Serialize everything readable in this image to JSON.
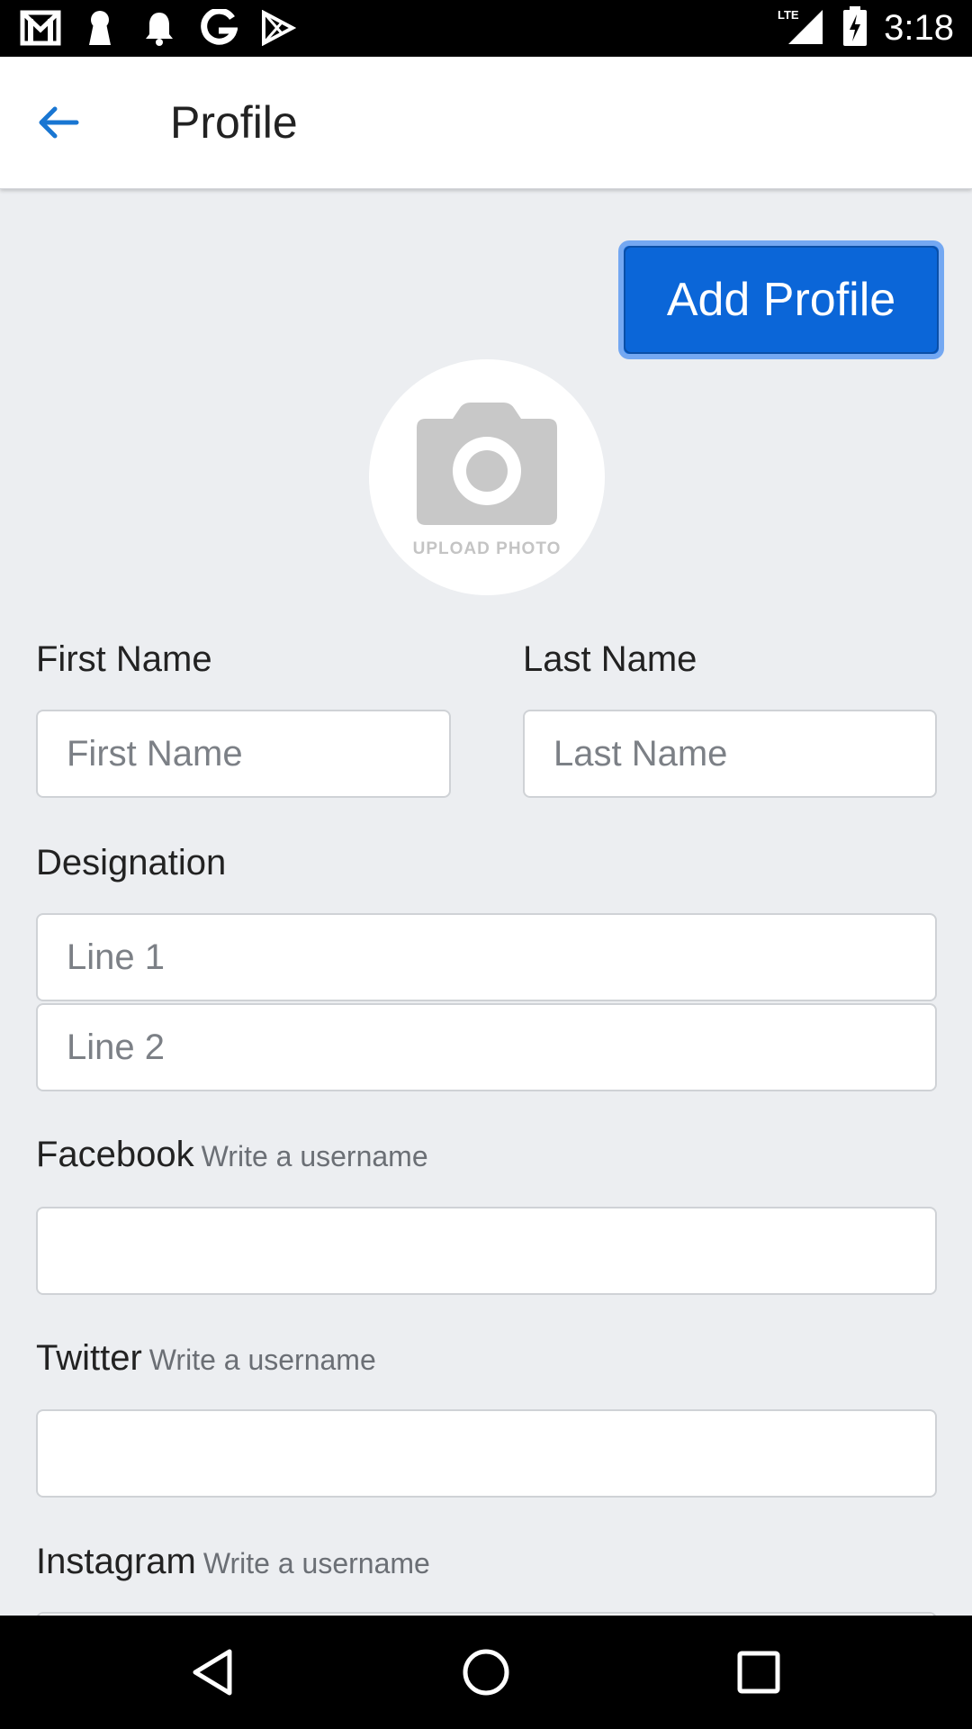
{
  "status_bar": {
    "time": "3:18",
    "network": "LTE",
    "icons": [
      "gmail-icon",
      "keyhole-icon",
      "bell-icon",
      "google-icon",
      "play-store-icon",
      "signal-icon",
      "battery-icon"
    ]
  },
  "app_bar": {
    "title": "Profile",
    "back_icon": "arrow-left-icon",
    "accent": "#1976d2"
  },
  "actions": {
    "add_profile_label": "Add Profile",
    "button_color": "#0b66d8"
  },
  "photo": {
    "upload_label": "UPLOAD PHOTO",
    "icon": "camera-icon"
  },
  "form": {
    "first_name": {
      "label": "First Name",
      "placeholder": "First Name",
      "value": ""
    },
    "last_name": {
      "label": "Last Name",
      "placeholder": "Last Name",
      "value": ""
    },
    "designation": {
      "label": "Designation",
      "line1_placeholder": "Line 1",
      "line2_placeholder": "Line 2"
    },
    "facebook": {
      "label": "Facebook",
      "hint": "Write a username",
      "value": ""
    },
    "twitter": {
      "label": "Twitter",
      "hint": "Write a username",
      "value": ""
    },
    "instagram": {
      "label": "Instagram",
      "hint": "Write a username",
      "value": ""
    }
  },
  "nav_bar": {
    "icons": [
      "back-triangle-icon",
      "home-circle-icon",
      "recents-square-icon"
    ]
  }
}
